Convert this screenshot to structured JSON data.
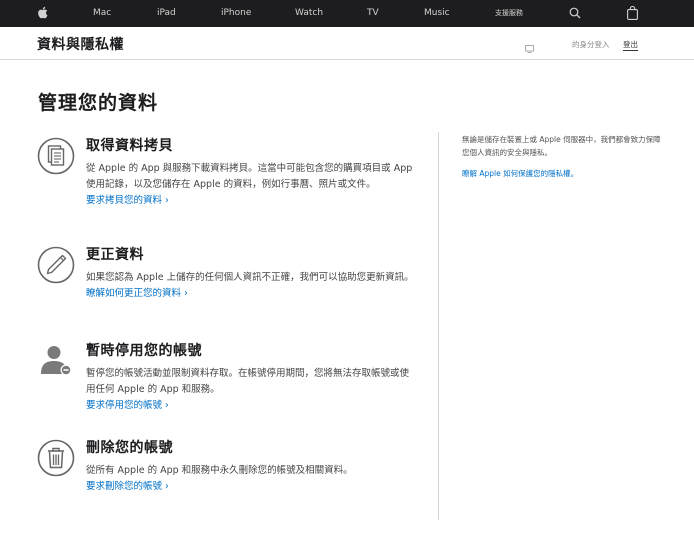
{
  "global_nav": {
    "items": [
      "Mac",
      "iPad",
      "iPhone",
      "Watch",
      "TV",
      "Music",
      "支援服務"
    ]
  },
  "local_nav": {
    "title": "資料與隱私權",
    "signed_in": "的身分登入",
    "sign_out": "登出"
  },
  "page": {
    "title": "管理您的資料"
  },
  "sections": [
    {
      "icon": "document-copy-icon",
      "title": "取得資料拷貝",
      "body": "從 Apple 的 App 與服務下載資料拷貝。這當中可能包含您的購買項目或 App 使用記錄，以及您儲存在 Apple 的資料，例如行事曆、照片或文件。",
      "link": "要求拷貝您的資料 ›"
    },
    {
      "icon": "pencil-icon",
      "title": "更正資料",
      "body": "如果您認為 Apple 上儲存的任何個人資訊不正確，我們可以協助您更新資訊。",
      "link": "瞭解如何更正您的資料 ›"
    },
    {
      "icon": "user-deactivate-icon",
      "title": "暫時停用您的帳號",
      "body": "暫停您的帳號活動並限制資料存取。在帳號停用期間，您將無法存取帳號或使用任何 Apple 的 App 和服務。",
      "link": "要求停用您的帳號 ›"
    },
    {
      "icon": "trash-icon",
      "title": "刪除您的帳號",
      "body": "從所有 Apple 的 App 和服務中永久刪除您的帳號及相關資料。",
      "link": "要求刪除您的帳號 ›"
    }
  ],
  "aside": {
    "text": "無論是儲存在裝置上或 Apple 伺服器中，我們都會致力保障您個人資訊的安全與隱私。",
    "link": "瞭解 Apple 如何保護您的隱私權。"
  },
  "colors": {
    "nav_bg": "#1d1d1f",
    "link": "#0070c9"
  }
}
